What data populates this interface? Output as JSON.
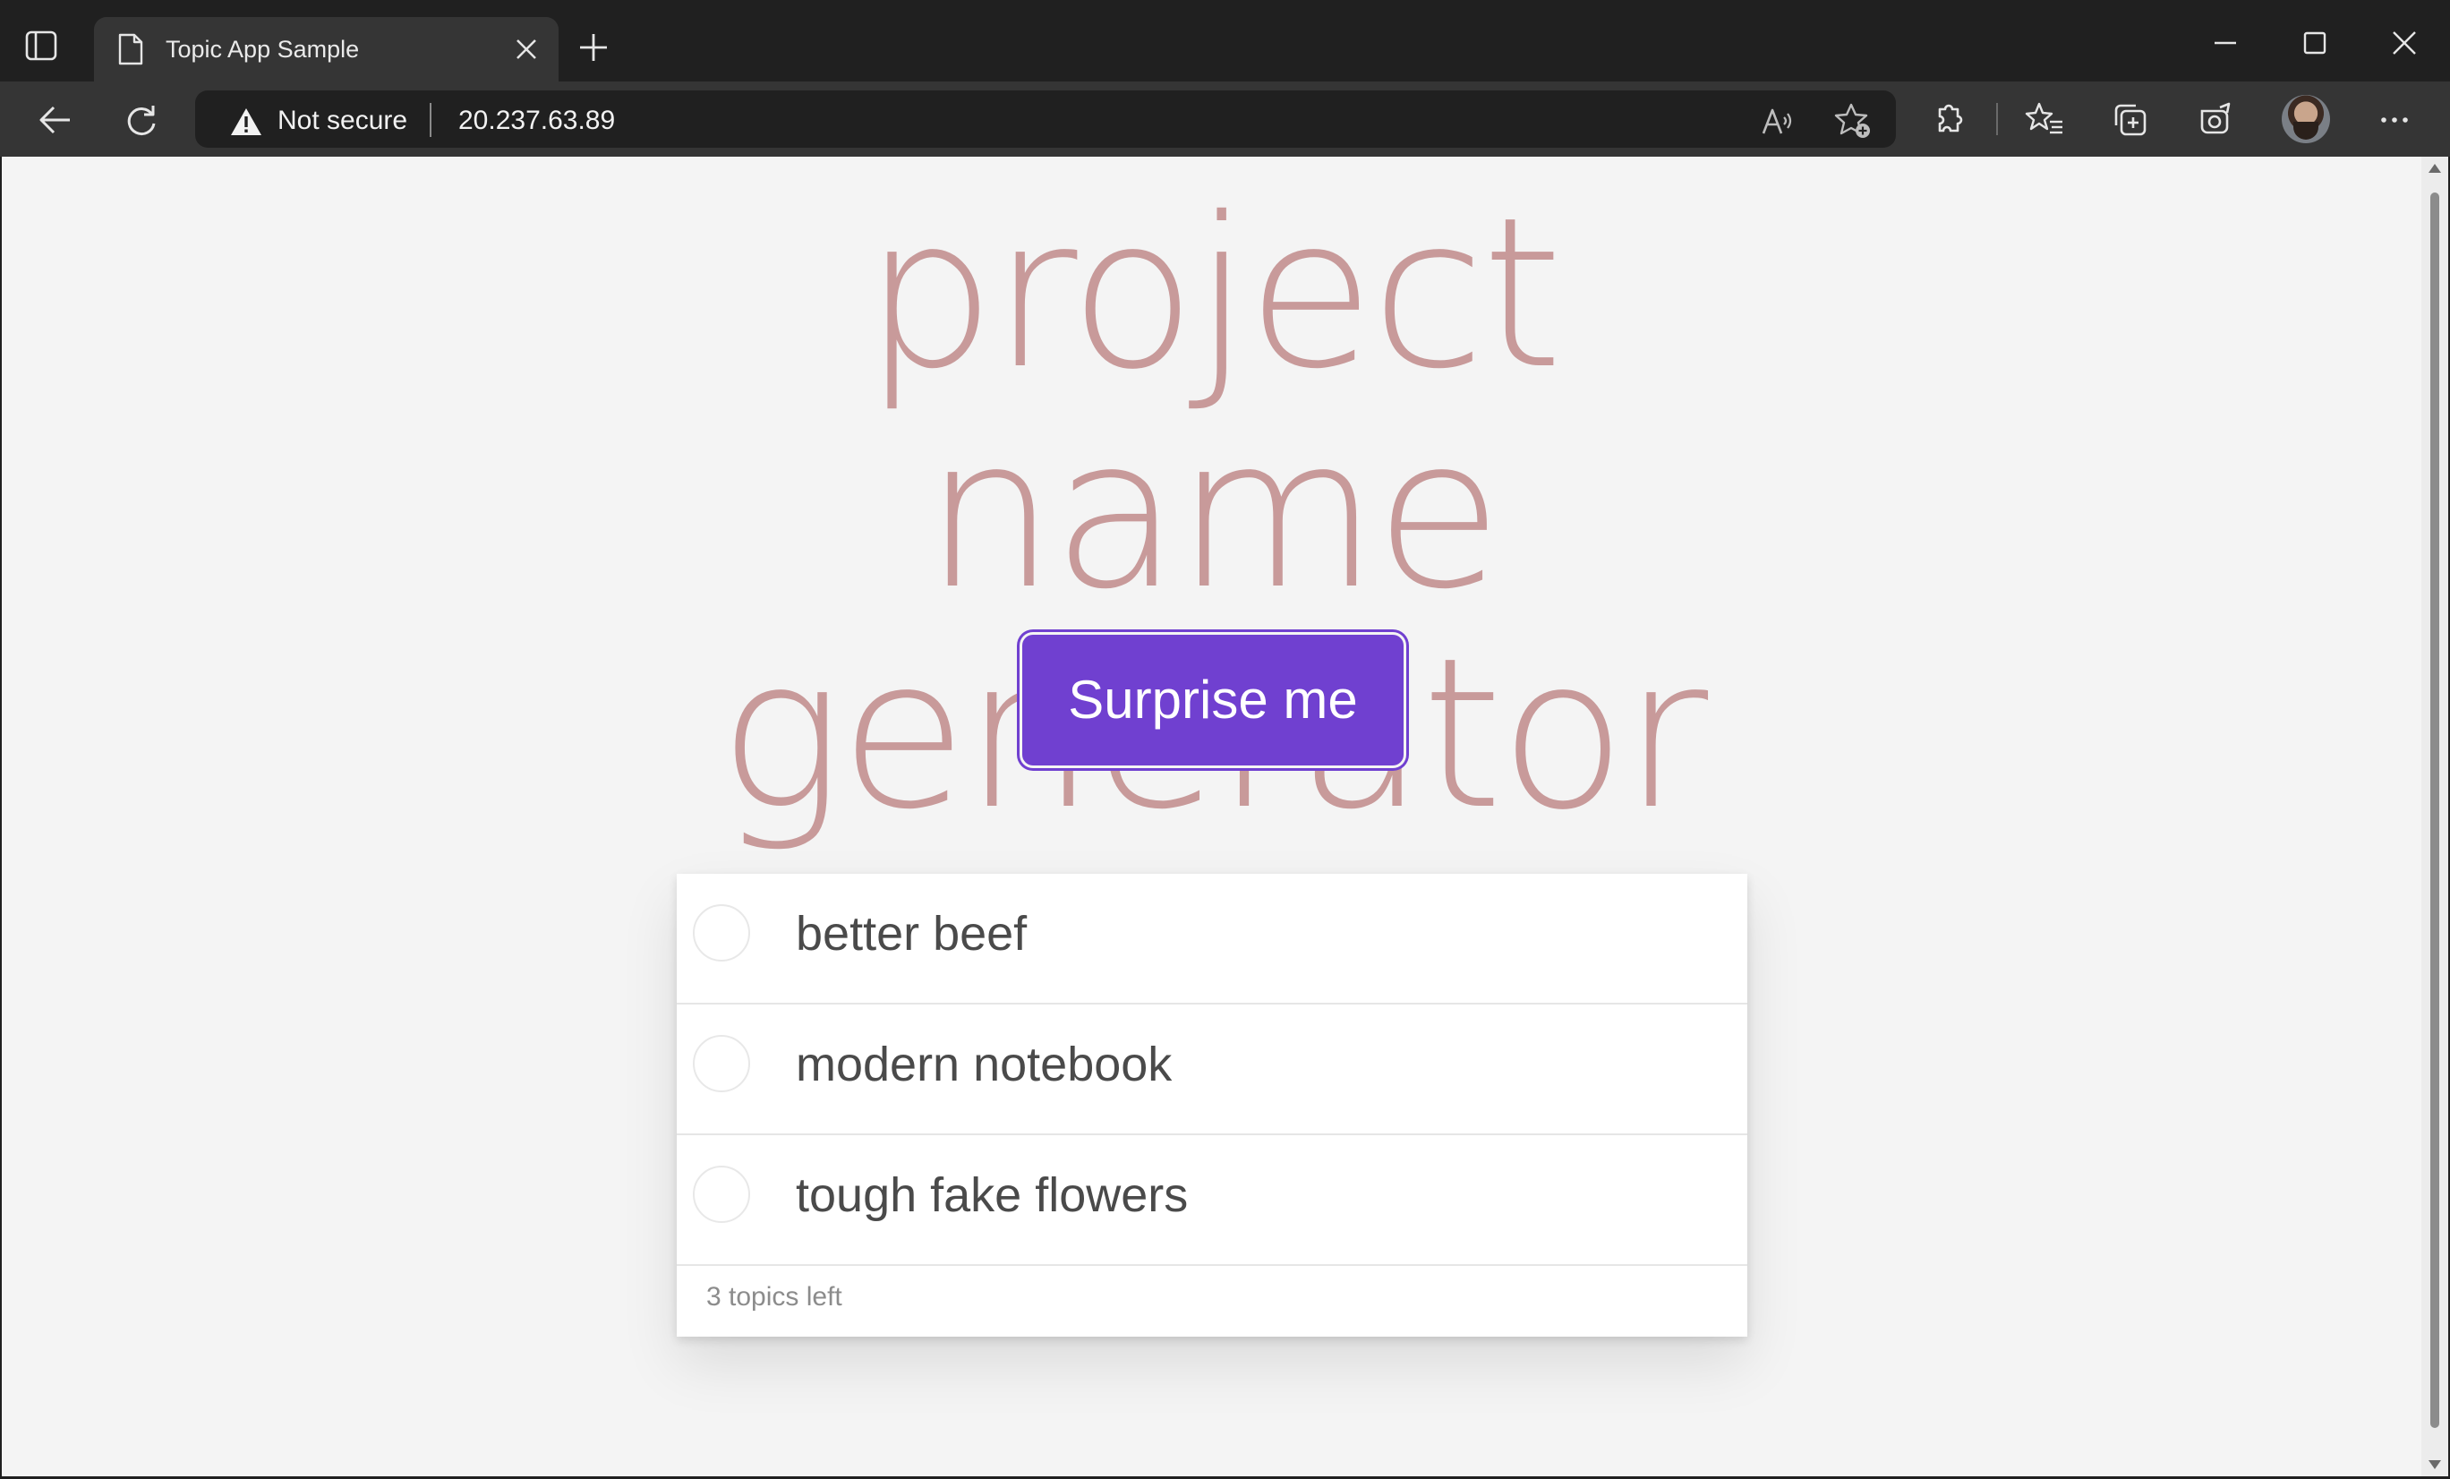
{
  "browser": {
    "tab": {
      "title": "Topic App Sample"
    },
    "address": {
      "security_label": "Not secure",
      "url": "20.237.63.89"
    }
  },
  "page": {
    "title": "project name generator",
    "surprise_button": "Surprise me",
    "topics": [
      {
        "label": "better beef",
        "done": false
      },
      {
        "label": "modern notebook",
        "done": false
      },
      {
        "label": "tough fake flowers",
        "done": false
      }
    ],
    "footer": {
      "count_text": "3 topics left"
    }
  },
  "colors": {
    "title": "#c89a9a",
    "button": "#7040d0",
    "chrome_dark": "#202020",
    "chrome_toolbar": "#353535"
  },
  "icons": [
    "tab-actions-icon",
    "page-icon",
    "close-icon",
    "plus-icon",
    "minimize-icon",
    "maximize-icon",
    "window-close-icon",
    "back-icon",
    "refresh-icon",
    "warning-icon",
    "read-aloud-icon",
    "add-favorite-icon",
    "extensions-icon",
    "favorites-icon",
    "collections-icon",
    "copilot-icon",
    "more-icon"
  ]
}
